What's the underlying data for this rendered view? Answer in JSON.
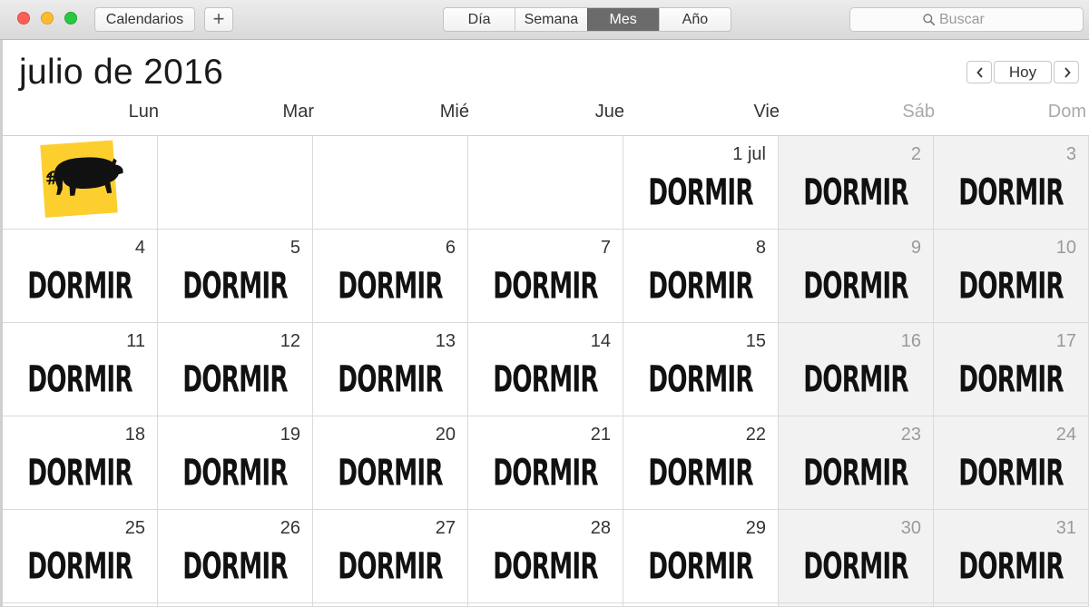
{
  "toolbar": {
    "calendars_label": "Calendarios",
    "add_label": "+",
    "views": [
      {
        "label": "Día",
        "active": false
      },
      {
        "label": "Semana",
        "active": false
      },
      {
        "label": "Mes",
        "active": true
      },
      {
        "label": "Año",
        "active": false
      }
    ],
    "search": {
      "placeholder": "Buscar",
      "value": "",
      "icon": "search-icon"
    }
  },
  "header": {
    "title": "julio de 2016",
    "today_label": "Hoy",
    "prev_icon": "chevron-left-icon",
    "next_icon": "chevron-right-icon"
  },
  "weekdays": [
    {
      "label": "Lun",
      "weekend": false
    },
    {
      "label": "Mar",
      "weekend": false
    },
    {
      "label": "Mié",
      "weekend": false
    },
    {
      "label": "Jue",
      "weekend": false
    },
    {
      "label": "Vie",
      "weekend": false
    },
    {
      "label": "Sáb",
      "weekend": true
    },
    {
      "label": "Dom",
      "weekend": true
    }
  ],
  "logo": {
    "icon": "pig-logo-icon",
    "text": "#"
  },
  "event_label": "DORMIR",
  "days": [
    {
      "label": "",
      "weekend": false,
      "event": "",
      "logo": true
    },
    {
      "label": "",
      "weekend": false,
      "event": ""
    },
    {
      "label": "",
      "weekend": false,
      "event": ""
    },
    {
      "label": "",
      "weekend": false,
      "event": ""
    },
    {
      "label": "1 jul",
      "weekend": false,
      "event": "DORMIR"
    },
    {
      "label": "2",
      "weekend": true,
      "event": "DORMIR"
    },
    {
      "label": "3",
      "weekend": true,
      "event": "DORMIR"
    },
    {
      "label": "4",
      "weekend": false,
      "event": "DORMIR"
    },
    {
      "label": "5",
      "weekend": false,
      "event": "DORMIR"
    },
    {
      "label": "6",
      "weekend": false,
      "event": "DORMIR"
    },
    {
      "label": "7",
      "weekend": false,
      "event": "DORMIR"
    },
    {
      "label": "8",
      "weekend": false,
      "event": "DORMIR"
    },
    {
      "label": "9",
      "weekend": true,
      "event": "DORMIR"
    },
    {
      "label": "10",
      "weekend": true,
      "event": "DORMIR"
    },
    {
      "label": "11",
      "weekend": false,
      "event": "DORMIR"
    },
    {
      "label": "12",
      "weekend": false,
      "event": "DORMIR"
    },
    {
      "label": "13",
      "weekend": false,
      "event": "DORMIR"
    },
    {
      "label": "14",
      "weekend": false,
      "event": "DORMIR"
    },
    {
      "label": "15",
      "weekend": false,
      "event": "DORMIR"
    },
    {
      "label": "16",
      "weekend": true,
      "event": "DORMIR"
    },
    {
      "label": "17",
      "weekend": true,
      "event": "DORMIR"
    },
    {
      "label": "18",
      "weekend": false,
      "event": "DORMIR"
    },
    {
      "label": "19",
      "weekend": false,
      "event": "DORMIR"
    },
    {
      "label": "20",
      "weekend": false,
      "event": "DORMIR"
    },
    {
      "label": "21",
      "weekend": false,
      "event": "DORMIR"
    },
    {
      "label": "22",
      "weekend": false,
      "event": "DORMIR"
    },
    {
      "label": "23",
      "weekend": true,
      "event": "DORMIR"
    },
    {
      "label": "24",
      "weekend": true,
      "event": "DORMIR"
    },
    {
      "label": "25",
      "weekend": false,
      "event": "DORMIR"
    },
    {
      "label": "26",
      "weekend": false,
      "event": "DORMIR"
    },
    {
      "label": "27",
      "weekend": false,
      "event": "DORMIR"
    },
    {
      "label": "28",
      "weekend": false,
      "event": "DORMIR"
    },
    {
      "label": "29",
      "weekend": false,
      "event": "DORMIR"
    },
    {
      "label": "30",
      "weekend": true,
      "event": "DORMIR"
    },
    {
      "label": "31",
      "weekend": true,
      "event": "DORMIR"
    }
  ],
  "colors": {
    "active_segment": "#6b6b6b",
    "weekend_background": "#f2f2f2",
    "logo_yellow": "#fccf2e"
  }
}
